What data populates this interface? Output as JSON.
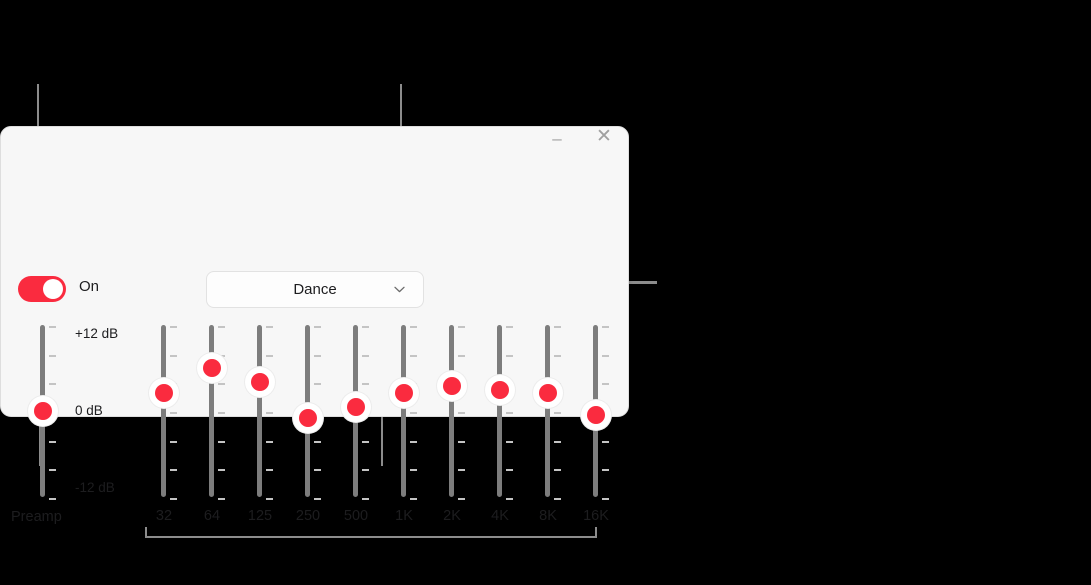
{
  "window": {
    "background_color": "#f7f7f7",
    "accent_color": "#fa2b3f",
    "minimize_label": "–",
    "close_label": "✕"
  },
  "power": {
    "state_label": "On",
    "enabled": true
  },
  "preset": {
    "selected": "Dance",
    "chevron_icon": "chevron-down-icon",
    "options": [
      "Dance"
    ]
  },
  "scale": {
    "top_label": "+12 dB",
    "mid_label": "0 dB",
    "bottom_label": "-12 dB",
    "max_db": 12,
    "min_db": -12,
    "tick_values": [
      12,
      8,
      4,
      0,
      -4,
      -8,
      -12
    ]
  },
  "preamp": {
    "label": "Preamp",
    "value_db": 0
  },
  "bands": [
    {
      "label": "32",
      "value_db": 2.5
    },
    {
      "label": "64",
      "value_db": 6.0
    },
    {
      "label": "125",
      "value_db": 4.0
    },
    {
      "label": "250",
      "value_db": -1.0
    },
    {
      "label": "500",
      "value_db": 0.5
    },
    {
      "label": "1K",
      "value_db": 2.5
    },
    {
      "label": "2K",
      "value_db": 3.5
    },
    {
      "label": "4K",
      "value_db": 3.0
    },
    {
      "label": "8K",
      "value_db": 2.5
    },
    {
      "label": "16K",
      "value_db": -0.5
    }
  ]
}
